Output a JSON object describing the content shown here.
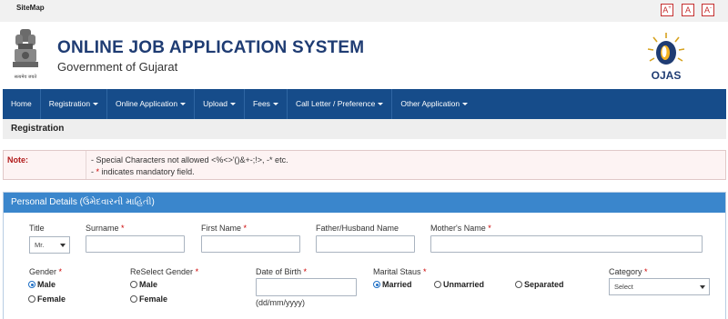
{
  "topbar": {
    "sitemap": "SiteMap",
    "font_buttons": [
      {
        "label": "A",
        "sup": "+"
      },
      {
        "label": "A",
        "sup": ""
      },
      {
        "label": "A",
        "sup": "-"
      }
    ]
  },
  "header": {
    "title": "ONLINE JOB APPLICATION SYSTEM",
    "subtitle": "Government of Gujarat",
    "logo_text": "OJAS",
    "emblem_caption": "सत्यमेव जयते"
  },
  "nav": {
    "items": [
      {
        "label": "Home",
        "dropdown": false
      },
      {
        "label": "Registration",
        "dropdown": true
      },
      {
        "label": "Online Application",
        "dropdown": true
      },
      {
        "label": "Upload",
        "dropdown": true
      },
      {
        "label": "Fees",
        "dropdown": true
      },
      {
        "label": "Call Letter / Preference",
        "dropdown": true
      },
      {
        "label": "Other Application",
        "dropdown": true
      }
    ]
  },
  "breadcrumb": {
    "title": "Registration"
  },
  "note": {
    "label": "Note:",
    "line1": "- Special Characters not allowed <%<>'()&+-;!>, -* etc.",
    "line2_prefix": "- ",
    "line2_star": "*",
    "line2_rest": " indicates mandatory field."
  },
  "personal_details": {
    "heading": "Personal Details (ઉમેદવારની માહિતી)",
    "title_label": "Title",
    "title_value": "Mr.",
    "surname_label": "Surname",
    "first_name_label": "First Name",
    "father_label": "Father/Husband Name",
    "mother_label": "Mother's Name",
    "gender_label": "Gender",
    "reselect_gender_label": "ReSelect Gender",
    "dob_label": "Date of Birth",
    "dob_hint": "(dd/mm/yyyy)",
    "marital_label": "Marital Staus",
    "category_label": "Category",
    "category_value": "Select",
    "required_mark": "*",
    "gender_options": [
      {
        "label": "Male",
        "checked": true
      },
      {
        "label": "Female",
        "checked": false
      }
    ],
    "reselect_options": [
      {
        "label": "Male",
        "checked": false
      },
      {
        "label": "Female",
        "checked": false
      }
    ],
    "marital_options": [
      {
        "label": "Married",
        "checked": true
      },
      {
        "label": "Unmarried",
        "checked": false
      },
      {
        "label": "Separated",
        "checked": false
      }
    ]
  },
  "colors": {
    "nav": "#164c8a",
    "panel_head": "#3a86cc",
    "title": "#1f3c73",
    "required": "#cc0000"
  }
}
